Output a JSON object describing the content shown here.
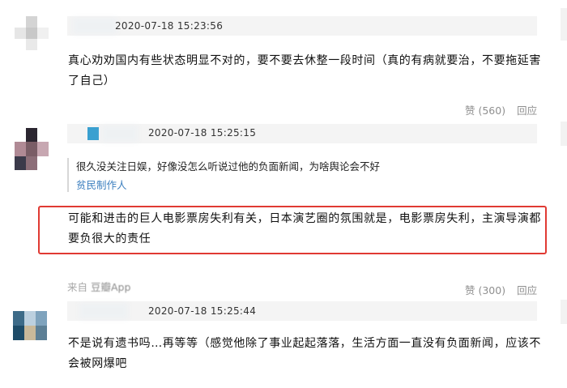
{
  "comments": [
    {
      "timestamp": "2020-07-18 15:23:56",
      "text_lines": [
        "真心劝劝国内有些状态明显不对的，要不要去休整一段时间（真的有病就要治，不要拖延害",
        "了自己）"
      ],
      "actions": {
        "like": "赞 (560)",
        "reply": "回应"
      },
      "avatar_colors": [
        "#ffffff",
        "#d4d4d4",
        "#ffffff",
        "#e6e6e6",
        "#c8c8c8",
        "#f0f0f0",
        "#ffffff",
        "#e9e9e9",
        "#ffffff"
      ]
    },
    {
      "timestamp": "2020-07-18 15:25:15",
      "quote": {
        "text": "很久没关注日娱，好像没怎么听说过他的负面新闻，为啥舆论会不好",
        "author": "贫民制作人"
      },
      "text_lines": [
        "可能和进击的巨人电影票房失利有关，日本演艺圈的氛围就是，电影票房失利，主演导演都",
        "要负很大的责任"
      ],
      "source": {
        "prefix": "来自",
        "app": "豆瓣App"
      },
      "actions": {
        "like": "赞 (300)",
        "reply": "回应"
      },
      "avatar_colors": [
        "#ffffff",
        "#2b2630",
        "#ffffff",
        "#b08a95",
        "#7a5d66",
        "#c7a7b1",
        "#3b3a4a",
        "#8c6e78",
        "#ffffff"
      ],
      "badge_color": "#3aa0d0"
    },
    {
      "timestamp": "2020-07-18 15:25:44",
      "text_lines": [
        "不是说有遗书吗…再等等（感觉他除了事业起起落落，生活方面一直没有负面新闻，应该不",
        "会被网爆吧"
      ],
      "avatar_colors": [
        "#ffffff",
        "#ffffff",
        "#ffffff",
        "#3d6b88",
        "#bcd0df",
        "#7fa3bd",
        "#1e4c68",
        "#c9b99a",
        "#5c7f95"
      ]
    }
  ],
  "colors": {
    "highlight": "#e03a33",
    "link": "#3c7fbf",
    "muted": "#8f8f8f"
  }
}
